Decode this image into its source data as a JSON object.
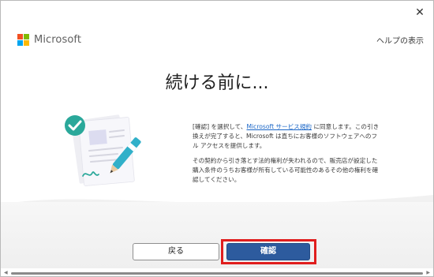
{
  "window": {
    "close_glyph": "✕"
  },
  "brand": {
    "name": "Microsoft",
    "logo_colors": [
      "#f25022",
      "#7fba00",
      "#00a4ef",
      "#ffb900"
    ]
  },
  "header": {
    "help_link": "ヘルプの表示"
  },
  "main": {
    "title": "続ける前に...",
    "paragraph1_prefix": "[確認] を選択して、",
    "terms_link": "Microsoft サービス規約",
    "paragraph1_suffix": " に同意します。この引き換えが完了すると、Microsoft は直ちにお客様のソフトウェアへのフル アクセスを提供します。",
    "paragraph2": "その契約から引き落とす法的権利が失われるので、販売店が設定した購入条件のうちお客様が所有している可能性のあるその他の権利を確認してください。"
  },
  "footer": {
    "back_label": "戻る",
    "confirm_label": "確認"
  },
  "colors": {
    "accent": "#2d5b9e",
    "highlight": "#e01e1e",
    "link": "#1a66c7",
    "check_badge": "#2aa89a"
  }
}
